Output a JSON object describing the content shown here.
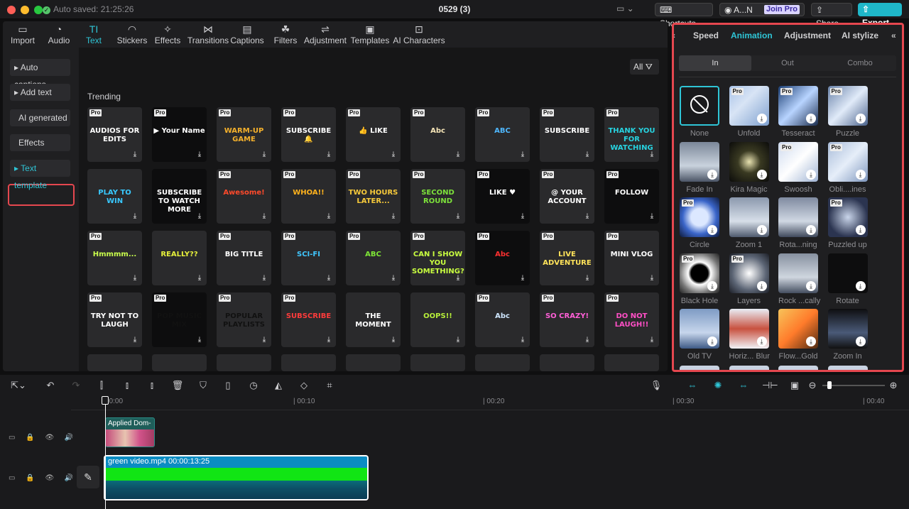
{
  "titlebar": {
    "autosave": "Auto saved: 21:25:26",
    "project_title": "0529 (3)",
    "shortcuts": "Shortcuts",
    "account": "A...N",
    "join_pro": "Join Pro",
    "share": "Share",
    "export": "Export"
  },
  "toolbar": [
    {
      "label": "Import",
      "icon": "▭"
    },
    {
      "label": "Audio",
      "icon": "◔"
    },
    {
      "label": "Text",
      "icon": "TI"
    },
    {
      "label": "Stickers",
      "icon": "◠"
    },
    {
      "label": "Effects",
      "icon": "✧"
    },
    {
      "label": "Transitions",
      "icon": "⋈"
    },
    {
      "label": "Captions",
      "icon": "▤"
    },
    {
      "label": "Filters",
      "icon": "☘"
    },
    {
      "label": "Adjustment",
      "icon": "⇌"
    },
    {
      "label": "Templates",
      "icon": "▣"
    },
    {
      "label": "AI Characters",
      "icon": "⊡"
    }
  ],
  "sidebar": [
    "Auto captions",
    "Add text",
    "AI generated",
    "Effects",
    "Text template"
  ],
  "content": {
    "all_label": "All",
    "section": "Trending"
  },
  "tiles": [
    {
      "text": "AUDIOS FOR EDITS",
      "color": "#ffffff",
      "pro": "Pro"
    },
    {
      "text": "▶ Your Name",
      "color": "#ffffff",
      "pro": "Pro",
      "dark": true
    },
    {
      "text": "WARM-UP GAME",
      "color": "#f5b12c",
      "pro": "Pro"
    },
    {
      "text": "SUBSCRIBE 🔔",
      "color": "#ffffff",
      "pro": "Pro"
    },
    {
      "text": "👍 LIKE",
      "color": "#ffffff",
      "pro": "Pro"
    },
    {
      "text": "Abc",
      "color": "#f7e6b8",
      "pro": "Pro"
    },
    {
      "text": "ABC",
      "color": "#4fb8ff",
      "pro": "Pro"
    },
    {
      "text": "SUBSCRIBE",
      "color": "#ffffff",
      "pro": "Pro"
    },
    {
      "text": "THANK YOU FOR WATCHING",
      "color": "#27d3e0",
      "pro": "Pro"
    },
    {
      "text": "PLAY TO WIN",
      "color": "#39c9ff",
      "pro": ""
    },
    {
      "text": "SUBSCRIBE TO WATCH MORE",
      "color": "#ffffff",
      "pro": "",
      "dark": true
    },
    {
      "text": "Awesome!",
      "color": "#ff4a2b",
      "pro": "Pro"
    },
    {
      "text": "WHOA!!",
      "color": "#ffb21d",
      "pro": "Pro"
    },
    {
      "text": "TWO HOURS LATER...",
      "color": "#f6c93a",
      "pro": "Pro"
    },
    {
      "text": "SECOND ROUND",
      "color": "#7de23b",
      "pro": "Pro"
    },
    {
      "text": "LIKE ♥",
      "color": "#ffffff",
      "pro": "Pro",
      "dark": true
    },
    {
      "text": "@ YOUR ACCOUNT",
      "color": "#ffffff",
      "pro": "Pro"
    },
    {
      "text": "FOLLOW",
      "color": "#ffffff",
      "pro": "Pro",
      "dark": true
    },
    {
      "text": "Hmmmm...",
      "color": "#caff4c",
      "pro": "Pro"
    },
    {
      "text": "REALLY??",
      "color": "#e6f03b",
      "pro": ""
    },
    {
      "text": "BIG TITLE",
      "color": "#ffffff",
      "pro": "Pro"
    },
    {
      "text": "SCI-FI",
      "color": "#40c7ff",
      "pro": "Pro"
    },
    {
      "text": "ABC",
      "color": "#7ee636",
      "pro": "Pro"
    },
    {
      "text": "CAN I SHOW YOU SOMETHING?",
      "color": "#c9ff40",
      "pro": "Pro"
    },
    {
      "text": "Abc",
      "color": "#ff3030",
      "pro": "Pro",
      "dark": true
    },
    {
      "text": "LIVE ADVENTURE",
      "color": "#ffe35a",
      "pro": "Pro"
    },
    {
      "text": "MINI VLOG",
      "color": "#ffffff",
      "pro": "Pro"
    },
    {
      "text": "TRY NOT TO LAUGH",
      "color": "#ffffff",
      "pro": "Pro"
    },
    {
      "text": "POP MUSIC MIX",
      "color": "#111111",
      "pro": "Pro",
      "dark": true
    },
    {
      "text": "POPULAR PLAYLISTS",
      "color": "#111111",
      "pro": "Pro"
    },
    {
      "text": "SUBSCRIBE",
      "color": "#ff3b3b",
      "pro": "Pro"
    },
    {
      "text": "THE MOMENT",
      "color": "#ffffff",
      "pro": ""
    },
    {
      "text": "OOPS!!",
      "color": "#b8ef3a",
      "pro": ""
    },
    {
      "text": "Abc",
      "color": "#cfe7ff",
      "pro": "Pro"
    },
    {
      "text": "SO CRAZY!",
      "color": "#ff5fd7",
      "pro": "Pro"
    },
    {
      "text": "DO NOT LAUGH!!",
      "color": "#ff4fc6",
      "pro": "Pro"
    }
  ],
  "right_panel": {
    "tabs": [
      "Speed",
      "Animation",
      "Adjustment",
      "AI stylize"
    ],
    "segments": [
      "In",
      "Out",
      "Combo"
    ],
    "animations": [
      {
        "name": "None",
        "pro": ""
      },
      {
        "name": "Unfold",
        "pro": "Pro"
      },
      {
        "name": "Tesseract",
        "pro": "Pro"
      },
      {
        "name": "Puzzle",
        "pro": "Pro"
      },
      {
        "name": "Fade In",
        "pro": ""
      },
      {
        "name": "Kira Magic",
        "pro": ""
      },
      {
        "name": "Swoosh",
        "pro": "Pro"
      },
      {
        "name": "Obli....ines",
        "pro": "Pro"
      },
      {
        "name": "Circle",
        "pro": "Pro"
      },
      {
        "name": "Zoom 1",
        "pro": ""
      },
      {
        "name": "Rota...ning",
        "pro": ""
      },
      {
        "name": "Puzzled up",
        "pro": "Pro"
      },
      {
        "name": "Black Hole",
        "pro": "Pro"
      },
      {
        "name": "Layers",
        "pro": "Pro"
      },
      {
        "name": "Rock ...cally",
        "pro": ""
      },
      {
        "name": "Rotate",
        "pro": ""
      },
      {
        "name": "Old TV",
        "pro": ""
      },
      {
        "name": "Horiz... Blur",
        "pro": ""
      },
      {
        "name": "Flow...Gold",
        "pro": ""
      },
      {
        "name": "Zoom In",
        "pro": ""
      }
    ]
  },
  "timeline": {
    "ticks": [
      "00:00",
      "| 00:10",
      "| 00:20",
      "| 00:30",
      "| 00:40"
    ],
    "clip1_label": "Applied  Dom-",
    "clip2_label": "green video.mp4   00:00:13:25"
  }
}
